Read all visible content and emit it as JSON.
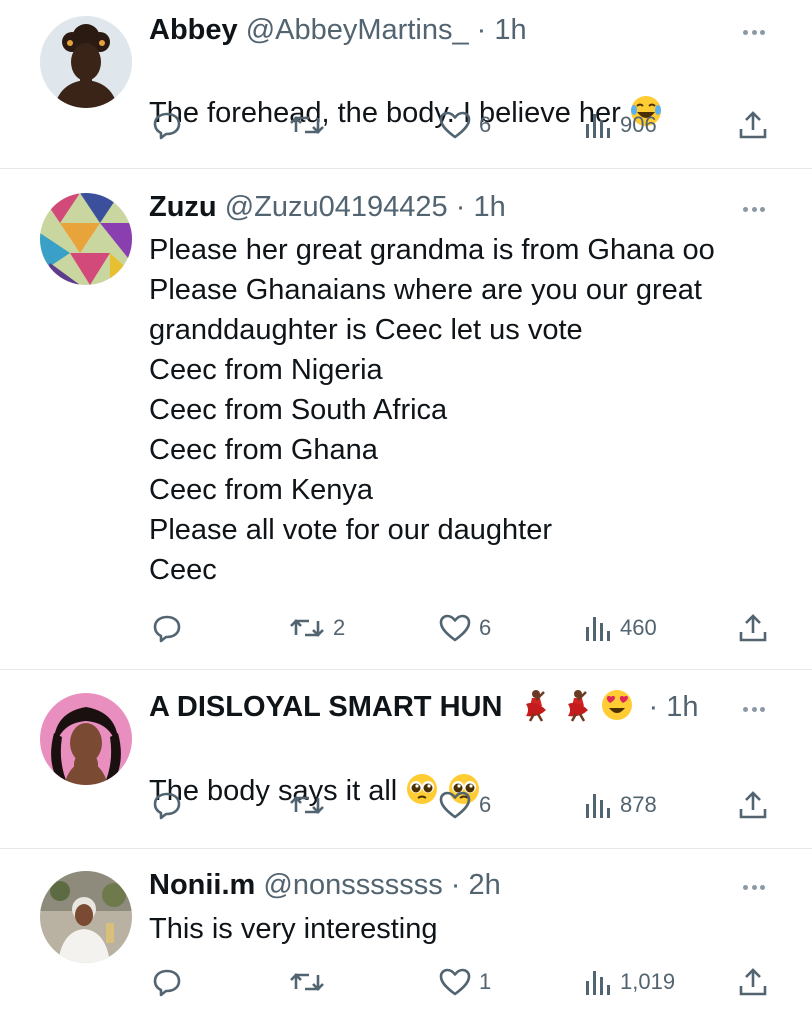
{
  "tweets": [
    {
      "name": "Abbey",
      "handle": "@AbbeyMartins_",
      "time": "1h",
      "text": "The forehead, the body. I believe her",
      "emojis": [
        "laughing-tears-emoji"
      ],
      "replies": "",
      "retweets": "",
      "likes": "6",
      "views": "906"
    },
    {
      "name": "Zuzu",
      "handle": "@Zuzu04194425",
      "time": "1h",
      "text": "Please her great grandma is from Ghana oo\nPlease Ghanaians where are you our great\ngranddaughter is Ceec let us vote\nCeec from Nigeria\nCeec from South Africa\nCeec from Ghana\nCeec from Kenya\nPlease all vote for our daughter\nCeec",
      "emojis": [],
      "replies": "",
      "retweets": "2",
      "likes": "6",
      "views": "460"
    },
    {
      "name": "A DISLOYAL SMART HUN",
      "name_emojis": [
        "dancer-emoji",
        "dancer-emoji",
        "heart-eyes-emoji"
      ],
      "handle": "",
      "time": "1h",
      "text": "The body says it all",
      "emojis": [
        "pleading-face-emoji",
        "pleading-face-emoji"
      ],
      "replies": "",
      "retweets": "",
      "likes": "6",
      "views": "878"
    },
    {
      "name": "Nonii.m",
      "handle": "@nonsssssss",
      "time": "2h",
      "text": "This is very interesting",
      "emojis": [],
      "replies": "",
      "retweets": "",
      "likes": "1",
      "views": "1,019"
    }
  ],
  "separator": "·",
  "colors": {
    "text": "#0f1419",
    "secondary": "#536471",
    "divider": "#e6e9eb"
  },
  "icons": [
    "reply-icon",
    "retweet-icon",
    "like-icon",
    "views-icon",
    "share-icon",
    "more-icon"
  ]
}
